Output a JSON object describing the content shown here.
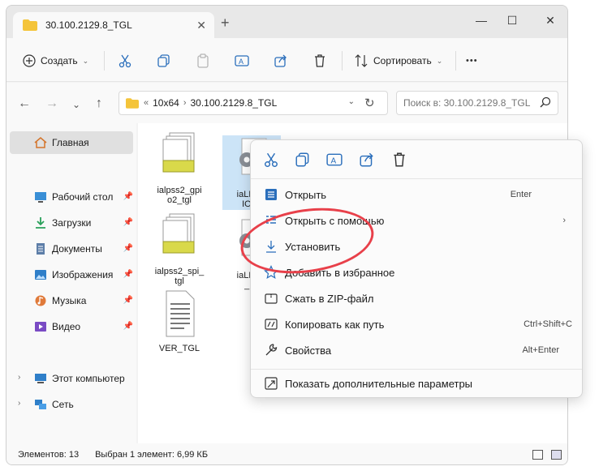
{
  "window": {
    "tab_title": "30.100.2129.8_TGL",
    "tab_close": "✕",
    "new_tab": "+",
    "minimize": "—",
    "maximize": "☐",
    "close": "✕"
  },
  "toolbar": {
    "create_label": "Создать",
    "sort_label": "Сортировать",
    "more": "•••",
    "caret": "⌄"
  },
  "nav": {
    "back": "←",
    "forward": "→",
    "recent": "⌄",
    "up": "↑",
    "breadcrumb_more": "«",
    "breadcrumb": [
      "10x64",
      "30.100.2129.8_TGL"
    ],
    "breadcrumb_sep": "›",
    "dropdown": "⌄",
    "refresh": "↻",
    "search_placeholder": "Поиск в: 30.100.2129.8_TGL"
  },
  "sidebar": {
    "home": "Главная",
    "items": [
      {
        "label": "Рабочий стол",
        "icon": "desktop-icon"
      },
      {
        "label": "Загрузки",
        "icon": "download-icon"
      },
      {
        "label": "Документы",
        "icon": "documents-icon"
      },
      {
        "label": "Изображения",
        "icon": "pictures-icon"
      },
      {
        "label": "Музыка",
        "icon": "music-icon"
      },
      {
        "label": "Видео",
        "icon": "video-icon"
      }
    ],
    "pin": "📌",
    "expand": "›",
    "this_pc": "Этот компьютер",
    "network": "Сеть"
  },
  "files": [
    {
      "name": "ialpss2_gpio2_tgl",
      "line1": "ialpss2_gpi",
      "line2": "o2_tgl",
      "icon": "inf-file-icon"
    },
    {
      "name": "iaLPSS2_GPIO2_TGL",
      "line1": "iaLPSS",
      "line2": "IO2_",
      "icon": "settings-file-icon"
    },
    {
      "name": "ialpss2_spi_tgl",
      "line1": "ialpss2_spi_",
      "line2": "tgl",
      "icon": "inf-file-icon"
    },
    {
      "name": "iaLPSS2_SPI",
      "line1": "iaLPSS",
      "line2": "_IO",
      "icon": "settings-file-icon"
    },
    {
      "name": "VER_TGL",
      "line1": "VER_TGL",
      "line2": "",
      "icon": "text-file-icon"
    }
  ],
  "status": {
    "items_count": "Элементов: 13",
    "selected": "Выбран 1 элемент: 6,99 КБ"
  },
  "context_menu": {
    "items": [
      {
        "label": "Открыть",
        "shortcut": "Enter",
        "icon": "open-icon"
      },
      {
        "label": "Открыть с помощью",
        "shortcut": "",
        "icon": "open-with-icon"
      },
      {
        "label": "Установить",
        "shortcut": "",
        "icon": "install-icon"
      },
      {
        "label": "Добавить в избранное",
        "shortcut": "",
        "icon": "star-icon"
      },
      {
        "label": "Сжать в ZIP-файл",
        "shortcut": "",
        "icon": "zip-icon"
      },
      {
        "label": "Копировать как путь",
        "shortcut": "Ctrl+Shift+C",
        "icon": "copy-path-icon"
      },
      {
        "label": "Свойства",
        "shortcut": "Alt+Enter",
        "icon": "properties-icon"
      },
      {
        "label": "Показать дополнительные параметры",
        "shortcut": "",
        "icon": "more-options-icon"
      }
    ],
    "submenu_arrow": "›"
  },
  "colors": {
    "accent": "#0067c0",
    "highlight_ring": "#e8404a",
    "selection": "#cce4f7",
    "folder": "#f4c43a"
  }
}
